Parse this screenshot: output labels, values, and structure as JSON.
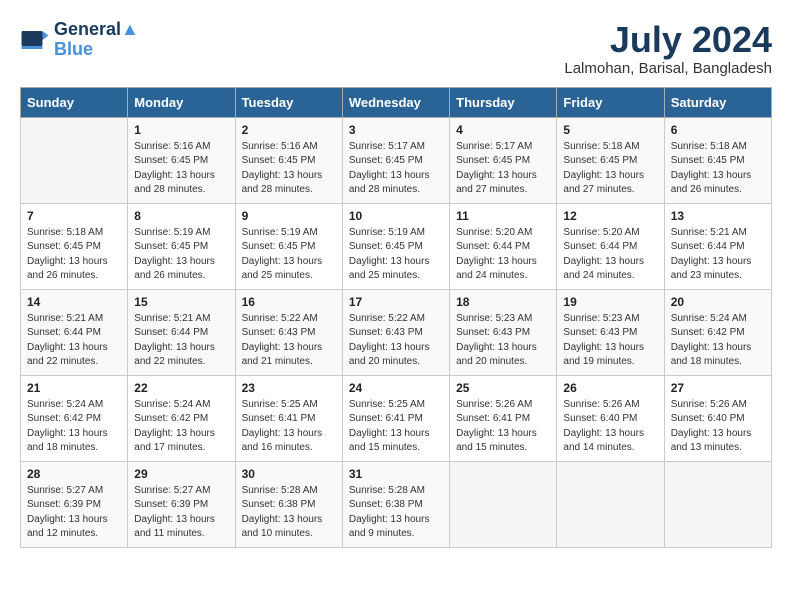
{
  "header": {
    "logo_line1": "General",
    "logo_line2": "Blue",
    "month_year": "July 2024",
    "location": "Lalmohan, Barisal, Bangladesh"
  },
  "days_of_week": [
    "Sunday",
    "Monday",
    "Tuesday",
    "Wednesday",
    "Thursday",
    "Friday",
    "Saturday"
  ],
  "weeks": [
    [
      {
        "day": "",
        "info": ""
      },
      {
        "day": "1",
        "info": "Sunrise: 5:16 AM\nSunset: 6:45 PM\nDaylight: 13 hours and 28 minutes."
      },
      {
        "day": "2",
        "info": "Sunrise: 5:16 AM\nSunset: 6:45 PM\nDaylight: 13 hours and 28 minutes."
      },
      {
        "day": "3",
        "info": "Sunrise: 5:17 AM\nSunset: 6:45 PM\nDaylight: 13 hours and 28 minutes."
      },
      {
        "day": "4",
        "info": "Sunrise: 5:17 AM\nSunset: 6:45 PM\nDaylight: 13 hours and 27 minutes."
      },
      {
        "day": "5",
        "info": "Sunrise: 5:18 AM\nSunset: 6:45 PM\nDaylight: 13 hours and 27 minutes."
      },
      {
        "day": "6",
        "info": "Sunrise: 5:18 AM\nSunset: 6:45 PM\nDaylight: 13 hours and 26 minutes."
      }
    ],
    [
      {
        "day": "7",
        "info": "Sunrise: 5:18 AM\nSunset: 6:45 PM\nDaylight: 13 hours and 26 minutes."
      },
      {
        "day": "8",
        "info": "Sunrise: 5:19 AM\nSunset: 6:45 PM\nDaylight: 13 hours and 26 minutes."
      },
      {
        "day": "9",
        "info": "Sunrise: 5:19 AM\nSunset: 6:45 PM\nDaylight: 13 hours and 25 minutes."
      },
      {
        "day": "10",
        "info": "Sunrise: 5:19 AM\nSunset: 6:45 PM\nDaylight: 13 hours and 25 minutes."
      },
      {
        "day": "11",
        "info": "Sunrise: 5:20 AM\nSunset: 6:44 PM\nDaylight: 13 hours and 24 minutes."
      },
      {
        "day": "12",
        "info": "Sunrise: 5:20 AM\nSunset: 6:44 PM\nDaylight: 13 hours and 24 minutes."
      },
      {
        "day": "13",
        "info": "Sunrise: 5:21 AM\nSunset: 6:44 PM\nDaylight: 13 hours and 23 minutes."
      }
    ],
    [
      {
        "day": "14",
        "info": "Sunrise: 5:21 AM\nSunset: 6:44 PM\nDaylight: 13 hours and 22 minutes."
      },
      {
        "day": "15",
        "info": "Sunrise: 5:21 AM\nSunset: 6:44 PM\nDaylight: 13 hours and 22 minutes."
      },
      {
        "day": "16",
        "info": "Sunrise: 5:22 AM\nSunset: 6:43 PM\nDaylight: 13 hours and 21 minutes."
      },
      {
        "day": "17",
        "info": "Sunrise: 5:22 AM\nSunset: 6:43 PM\nDaylight: 13 hours and 20 minutes."
      },
      {
        "day": "18",
        "info": "Sunrise: 5:23 AM\nSunset: 6:43 PM\nDaylight: 13 hours and 20 minutes."
      },
      {
        "day": "19",
        "info": "Sunrise: 5:23 AM\nSunset: 6:43 PM\nDaylight: 13 hours and 19 minutes."
      },
      {
        "day": "20",
        "info": "Sunrise: 5:24 AM\nSunset: 6:42 PM\nDaylight: 13 hours and 18 minutes."
      }
    ],
    [
      {
        "day": "21",
        "info": "Sunrise: 5:24 AM\nSunset: 6:42 PM\nDaylight: 13 hours and 18 minutes."
      },
      {
        "day": "22",
        "info": "Sunrise: 5:24 AM\nSunset: 6:42 PM\nDaylight: 13 hours and 17 minutes."
      },
      {
        "day": "23",
        "info": "Sunrise: 5:25 AM\nSunset: 6:41 PM\nDaylight: 13 hours and 16 minutes."
      },
      {
        "day": "24",
        "info": "Sunrise: 5:25 AM\nSunset: 6:41 PM\nDaylight: 13 hours and 15 minutes."
      },
      {
        "day": "25",
        "info": "Sunrise: 5:26 AM\nSunset: 6:41 PM\nDaylight: 13 hours and 15 minutes."
      },
      {
        "day": "26",
        "info": "Sunrise: 5:26 AM\nSunset: 6:40 PM\nDaylight: 13 hours and 14 minutes."
      },
      {
        "day": "27",
        "info": "Sunrise: 5:26 AM\nSunset: 6:40 PM\nDaylight: 13 hours and 13 minutes."
      }
    ],
    [
      {
        "day": "28",
        "info": "Sunrise: 5:27 AM\nSunset: 6:39 PM\nDaylight: 13 hours and 12 minutes."
      },
      {
        "day": "29",
        "info": "Sunrise: 5:27 AM\nSunset: 6:39 PM\nDaylight: 13 hours and 11 minutes."
      },
      {
        "day": "30",
        "info": "Sunrise: 5:28 AM\nSunset: 6:38 PM\nDaylight: 13 hours and 10 minutes."
      },
      {
        "day": "31",
        "info": "Sunrise: 5:28 AM\nSunset: 6:38 PM\nDaylight: 13 hours and 9 minutes."
      },
      {
        "day": "",
        "info": ""
      },
      {
        "day": "",
        "info": ""
      },
      {
        "day": "",
        "info": ""
      }
    ]
  ]
}
